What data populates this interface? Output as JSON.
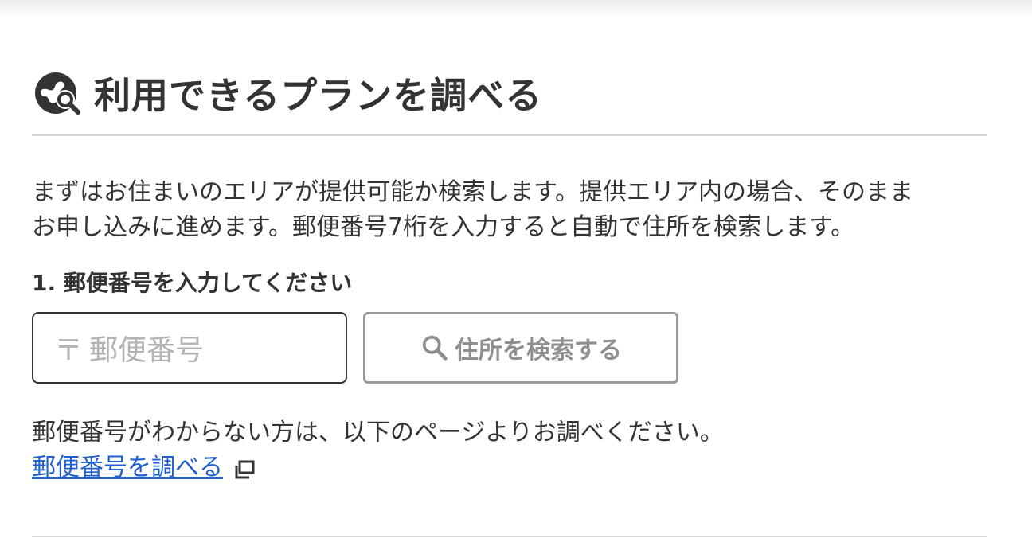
{
  "header": {
    "title": "利用できるプランを調べる",
    "icon": "globe-search-icon"
  },
  "intro": {
    "line1": "まずはお住まいのエリアが提供可能か検索します。提供エリア内の場合、そのまま",
    "line2": "お申し込みに進めます。郵便番号7桁を入力すると自動で住所を検索します。"
  },
  "step1": {
    "label": "1. 郵便番号を入力してください"
  },
  "zip_input": {
    "prefix": "〒",
    "placeholder": "郵便番号",
    "value": ""
  },
  "search_button": {
    "label": "住所を検索する",
    "icon": "search-icon"
  },
  "help": {
    "note": "郵便番号がわからない方は、以下のページよりお調べください。",
    "link_label": "郵便番号を調べる",
    "link_icon": "external-window-icon"
  },
  "colors": {
    "text": "#333333",
    "link": "#1f5fcf",
    "divider": "#d6d6d6",
    "disabled": "#8f8f8f"
  }
}
